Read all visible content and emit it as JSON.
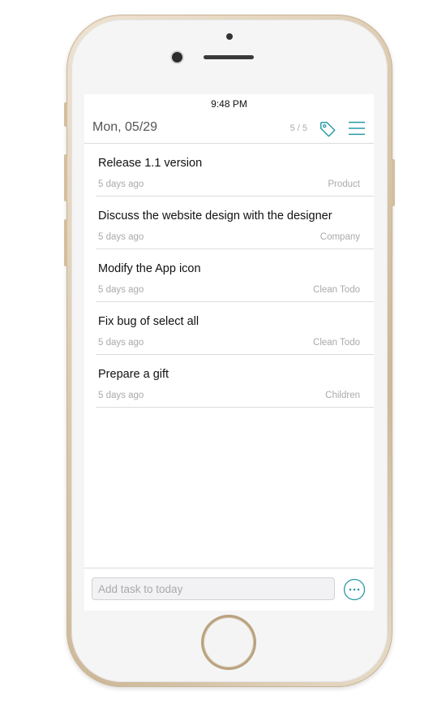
{
  "status_bar": {
    "time": "9:48 PM"
  },
  "header": {
    "date": "Mon, 05/29",
    "count": "5 / 5"
  },
  "tasks": [
    {
      "title": "Release 1.1 version",
      "time": "5 days ago",
      "tag": "Product"
    },
    {
      "title": "Discuss the website design with the designer",
      "time": "5 days ago",
      "tag": "Company"
    },
    {
      "title": "Modify the App icon",
      "time": "5 days ago",
      "tag": "Clean Todo"
    },
    {
      "title": "Fix bug of select all",
      "time": "5 days ago",
      "tag": "Clean Todo"
    },
    {
      "title": "Prepare a gift",
      "time": "5 days ago",
      "tag": "Children"
    }
  ],
  "bottom_bar": {
    "input_placeholder": "Add task to today",
    "input_value": ""
  },
  "icons": {
    "tags": "tag-icon",
    "menu": "hamburger-menu-icon",
    "more": "more-options-icon"
  },
  "colors": {
    "accent": "#2a9aa6",
    "phone_frame": "#d9c6aa"
  }
}
